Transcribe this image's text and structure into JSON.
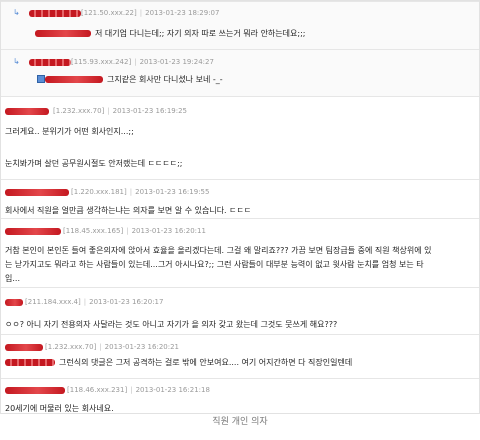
{
  "comments": [
    {
      "ip": "121.50.xxx.22",
      "date": "2013-01-23 18:29:07",
      "text": "저 대기업 다니는데;; 자기 의자 따로 쓰는거 뭐라 안하는데요;;;"
    },
    {
      "ip": "115.93.xxx.242",
      "date": "2013-01-23 19:24:27",
      "text": "그지같은 회사만 다니셨나 보네 -_-"
    },
    {
      "ip": "1.232.xxx.70",
      "date": "2013-01-23 16:19:25",
      "line1": "그러게요.. 분위기가 어떤 회사인지...;;",
      "line2": "눈치봐가며 살던 공무원시절도 안저랬는데 ㄷㄷㄷㄷ;;"
    },
    {
      "ip": "1.220.xxx.181",
      "date": "2013-01-23 16:19:55",
      "text": "회사에서 직원을 얼만큼 생각하는냐는 의자를 보면 알 수 있습니다. ㄷㄷㄷ"
    },
    {
      "ip": "118.45.xxx.165",
      "date": "2013-01-23 16:20:11",
      "line1": "거참 본인이 본인돈 들여 좋은의자에 앉아서 효율을 올리겠다는데. 그걸 왜 말리죠??? 가끔 보면 팀장급들 중에 직원 책상위에 있",
      "line2": "는 낟가지고도 뭐라고 하는 사람들이 있는데...그거 아시나요?;; 그런 사람들이 대부분 능력이 없고 윗사람 눈치를 엄청 보는 타",
      "line3": "입..."
    },
    {
      "ip": "211.184.xxx.4",
      "date": "2013-01-23 16:20:17",
      "text": "ㅇㅇ? 아니 자기 전용의자 사달라는 것도 아니고 자기가 을 의자 갖고 왔는데 그것도 뭇쓰게 해요???"
    },
    {
      "ip": "1.232.xxx.70",
      "date": "2013-01-23 16:20:21",
      "text": "그런식의 댓글은 그저 공격하는 걸로 밖에 안보여요.... 여기 어지간하면 다 직장인일텐데"
    },
    {
      "ip": "118.46.xxx.231",
      "date": "2013-01-23 16:21:18",
      "text": "20세기에 머물러 있는 회사네요."
    }
  ],
  "reply_icon": "reply-arrow-icon",
  "caption": "직원 개인 의자",
  "colors": {
    "nickname": "#c41820",
    "meta": "#9a9a9a",
    "divider": "#e6e6e6",
    "reply_icon": "#5b8ed6"
  }
}
